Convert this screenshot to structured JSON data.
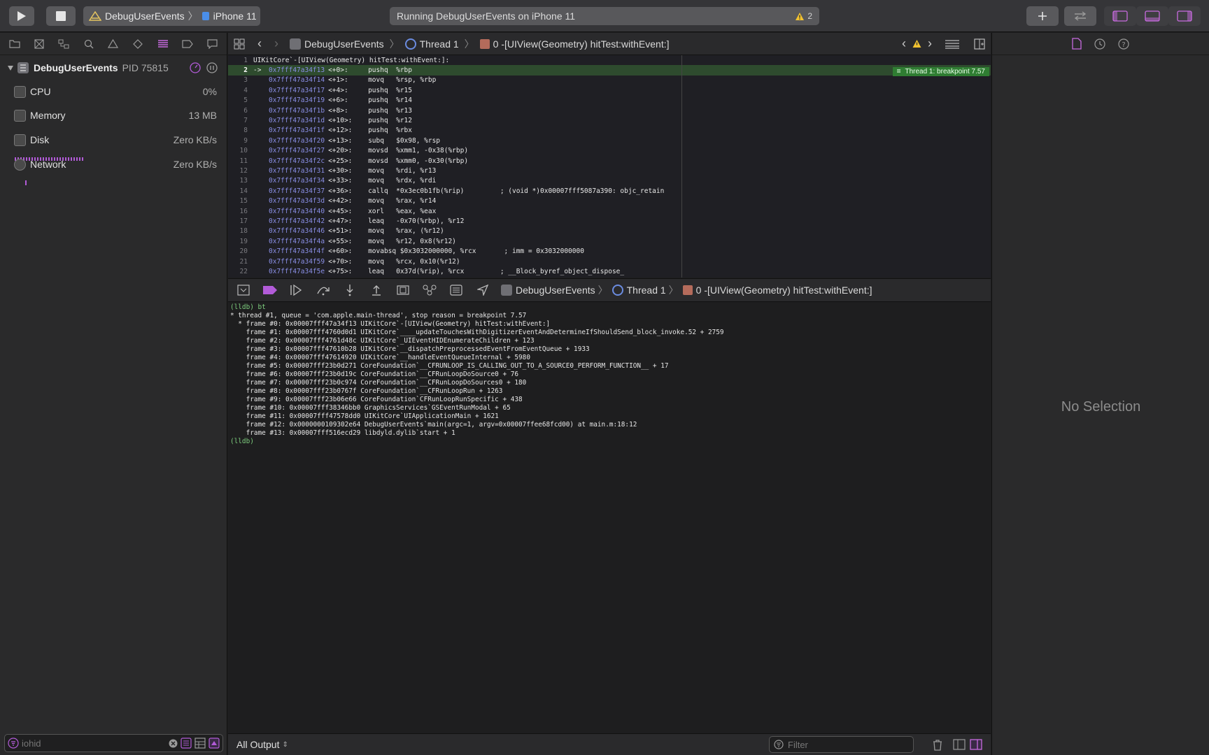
{
  "colors": {
    "accent": "#b25bd8",
    "breakpoint": "#2f7d32",
    "warning": "#f2c230",
    "address": "#8a8fe6"
  },
  "toolbar": {
    "scheme_name": "DebugUserEvents",
    "device_name": "iPhone 11",
    "activity_text": "Running DebugUserEvents on iPhone 11",
    "warning_count": "2"
  },
  "navigator": {
    "process_name": "DebugUserEvents",
    "process_pid": "PID 75815",
    "gauges": [
      {
        "label": "CPU",
        "value": "0%"
      },
      {
        "label": "Memory",
        "value": "13 MB"
      },
      {
        "label": "Disk",
        "value": "Zero KB/s"
      },
      {
        "label": "Network",
        "value": "Zero KB/s"
      }
    ],
    "filter_placeholder": "iohid"
  },
  "editor": {
    "breadcrumb": [
      "DebugUserEvents",
      "Thread 1",
      "0 -[UIView(Geometry) hitTest:withEvent:]"
    ],
    "breakpoint_tag": "Thread 1: breakpoint 7.57",
    "lines": [
      {
        "n": "1",
        "addr": "",
        "off": "",
        "code": "UIKitCore`-[UIView(Geometry) hitTest:withEvent:]:"
      },
      {
        "n": "2",
        "arrow": "->",
        "addr": "0x7fff47a34f13",
        "off": "<+0>:",
        "code": "pushq  %rbp",
        "current": true
      },
      {
        "n": "3",
        "addr": "0x7fff47a34f14",
        "off": "<+1>:",
        "code": "movq   %rsp, %rbp"
      },
      {
        "n": "4",
        "addr": "0x7fff47a34f17",
        "off": "<+4>:",
        "code": "pushq  %r15"
      },
      {
        "n": "5",
        "addr": "0x7fff47a34f19",
        "off": "<+6>:",
        "code": "pushq  %r14"
      },
      {
        "n": "6",
        "addr": "0x7fff47a34f1b",
        "off": "<+8>:",
        "code": "pushq  %r13"
      },
      {
        "n": "7",
        "addr": "0x7fff47a34f1d",
        "off": "<+10>:",
        "code": "pushq  %r12"
      },
      {
        "n": "8",
        "addr": "0x7fff47a34f1f",
        "off": "<+12>:",
        "code": "pushq  %rbx"
      },
      {
        "n": "9",
        "addr": "0x7fff47a34f20",
        "off": "<+13>:",
        "code": "subq   $0x98, %rsp"
      },
      {
        "n": "10",
        "addr": "0x7fff47a34f27",
        "off": "<+20>:",
        "code": "movsd  %xmm1, -0x38(%rbp)"
      },
      {
        "n": "11",
        "addr": "0x7fff47a34f2c",
        "off": "<+25>:",
        "code": "movsd  %xmm0, -0x30(%rbp)"
      },
      {
        "n": "12",
        "addr": "0x7fff47a34f31",
        "off": "<+30>:",
        "code": "movq   %rdi, %r13"
      },
      {
        "n": "13",
        "addr": "0x7fff47a34f34",
        "off": "<+33>:",
        "code": "movq   %rdx, %rdi"
      },
      {
        "n": "14",
        "addr": "0x7fff47a34f37",
        "off": "<+36>:",
        "code": "callq  *0x3ec0b1fb(%rip)         ; (void *)0x00007fff5087a390: objc_retain"
      },
      {
        "n": "15",
        "addr": "0x7fff47a34f3d",
        "off": "<+42>:",
        "code": "movq   %rax, %r14"
      },
      {
        "n": "16",
        "addr": "0x7fff47a34f40",
        "off": "<+45>:",
        "code": "xorl   %eax, %eax"
      },
      {
        "n": "17",
        "addr": "0x7fff47a34f42",
        "off": "<+47>:",
        "code": "leaq   -0x70(%rbp), %r12"
      },
      {
        "n": "18",
        "addr": "0x7fff47a34f46",
        "off": "<+51>:",
        "code": "movq   %rax, (%r12)"
      },
      {
        "n": "19",
        "addr": "0x7fff47a34f4a",
        "off": "<+55>:",
        "code": "movq   %r12, 0x8(%r12)"
      },
      {
        "n": "20",
        "addr": "0x7fff47a34f4f",
        "off": "<+60>:",
        "code": "movabsq $0x3032000000, %rcx       ; imm = 0x3032000000"
      },
      {
        "n": "21",
        "addr": "0x7fff47a34f59",
        "off": "<+70>:",
        "code": "movq   %rcx, 0x10(%r12)"
      },
      {
        "n": "22",
        "addr": "0x7fff47a34f5e",
        "off": "<+75>:",
        "code": "leaq   0x37d(%rip), %rcx         ; __Block_byref_object_dispose_"
      }
    ]
  },
  "debug_bar": {
    "breadcrumb": [
      "DebugUserEvents",
      "Thread 1",
      "0 -[UIView(Geometry) hitTest:withEvent:]"
    ]
  },
  "console": {
    "lines": [
      {
        "t": "(lldb) bt",
        "prompt": true
      },
      {
        "t": "* thread #1, queue = 'com.apple.main-thread', stop reason = breakpoint 7.57"
      },
      {
        "t": "  * frame #0: 0x00007fff47a34f13 UIKitCore`-[UIView(Geometry) hitTest:withEvent:]"
      },
      {
        "t": "    frame #1: 0x00007fff4760d0d1 UIKitCore`____updateTouchesWithDigitizerEventAndDetermineIfShouldSend_block_invoke.52 + 2759"
      },
      {
        "t": "    frame #2: 0x00007fff4761d48c UIKitCore`_UIEventHIDEnumerateChildren + 123"
      },
      {
        "t": "    frame #3: 0x00007fff47610b28 UIKitCore`__dispatchPreprocessedEventFromEventQueue + 1933"
      },
      {
        "t": "    frame #4: 0x00007fff47614920 UIKitCore`__handleEventQueueInternal + 5980"
      },
      {
        "t": "    frame #5: 0x00007fff23b0d271 CoreFoundation`__CFRUNLOOP_IS_CALLING_OUT_TO_A_SOURCE0_PERFORM_FUNCTION__ + 17"
      },
      {
        "t": "    frame #6: 0x00007fff23b0d19c CoreFoundation`__CFRunLoopDoSource0 + 76"
      },
      {
        "t": "    frame #7: 0x00007fff23b0c974 CoreFoundation`__CFRunLoopDoSources0 + 180"
      },
      {
        "t": "    frame #8: 0x00007fff23b0767f CoreFoundation`__CFRunLoopRun + 1263"
      },
      {
        "t": "    frame #9: 0x00007fff23b06e66 CoreFoundation`CFRunLoopRunSpecific + 438"
      },
      {
        "t": "    frame #10: 0x00007fff38346bb0 GraphicsServices`GSEventRunModal + 65"
      },
      {
        "t": "    frame #11: 0x00007fff47578dd0 UIKitCore`UIApplicationMain + 1621"
      },
      {
        "t": "    frame #12: 0x0000000109302e64 DebugUserEvents`main(argc=1, argv=0x00007ffee68fcd00) at main.m:18:12"
      },
      {
        "t": "    frame #13: 0x00007fff516ecd29 libdyld.dylib`start + 1"
      },
      {
        "t": "(lldb)",
        "prompt": true
      }
    ],
    "output_selector": "All Output",
    "filter_placeholder": "Filter"
  },
  "inspector": {
    "empty_text": "No Selection"
  }
}
